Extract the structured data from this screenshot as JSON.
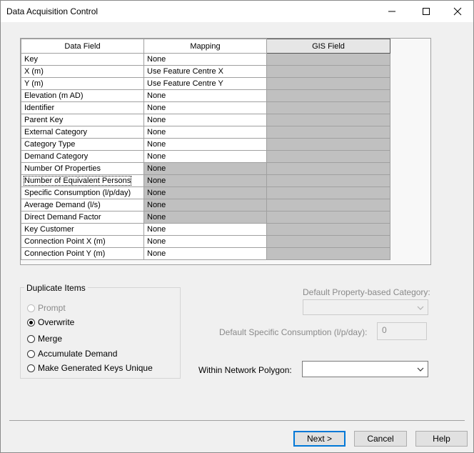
{
  "window": {
    "title": "Data Acquisition Control"
  },
  "grid": {
    "columns": [
      "Data Field",
      "Mapping",
      "GIS Field"
    ],
    "rows": [
      {
        "field": "Key",
        "mapping": "None",
        "gray": false
      },
      {
        "field": "X (m)",
        "mapping": "Use Feature Centre X",
        "gray": false
      },
      {
        "field": "Y (m)",
        "mapping": "Use Feature Centre Y",
        "gray": false
      },
      {
        "field": "Elevation (m AD)",
        "mapping": "None",
        "gray": false
      },
      {
        "field": "Identifier",
        "mapping": "None",
        "gray": false
      },
      {
        "field": "Parent Key",
        "mapping": "None",
        "gray": false
      },
      {
        "field": "External Category",
        "mapping": "None",
        "gray": false
      },
      {
        "field": "Category Type",
        "mapping": "None",
        "gray": false
      },
      {
        "field": "Demand Category",
        "mapping": "None",
        "gray": false
      },
      {
        "field": "Number Of Properties",
        "mapping": "None",
        "gray": true
      },
      {
        "field": "Number of Equivalent Persons",
        "mapping": "None",
        "gray": true
      },
      {
        "field": "Specific Consumption (l/p/day)",
        "mapping": "None",
        "gray": true
      },
      {
        "field": "Average Demand (l/s)",
        "mapping": "None",
        "gray": true
      },
      {
        "field": "Direct Demand Factor",
        "mapping": "None",
        "gray": true
      },
      {
        "field": "Key Customer",
        "mapping": "None",
        "gray": false
      },
      {
        "field": "Connection Point X (m)",
        "mapping": "None",
        "gray": false
      },
      {
        "field": "Connection Point Y (m)",
        "mapping": "None",
        "gray": false
      }
    ]
  },
  "duplicates": {
    "label": "Duplicate Items",
    "options": {
      "prompt": "Prompt",
      "overwrite": "Overwrite",
      "merge": "Merge",
      "accumulate": "Accumulate Demand",
      "unique": "Make Generated Keys Unique"
    },
    "selected": "Overwrite"
  },
  "defaults": {
    "category_label": "Default Property-based Category:",
    "category_value": "",
    "consumption_label": "Default Specific Consumption (l/p/day):",
    "consumption_value": "0"
  },
  "polygon": {
    "label": "Within Network Polygon:",
    "value": ""
  },
  "buttons": {
    "next": "Next >",
    "cancel": "Cancel",
    "help": "Help"
  },
  "colors": {
    "default_button_border": "#0078d7",
    "disabled_cell": "#c0c0c0"
  }
}
